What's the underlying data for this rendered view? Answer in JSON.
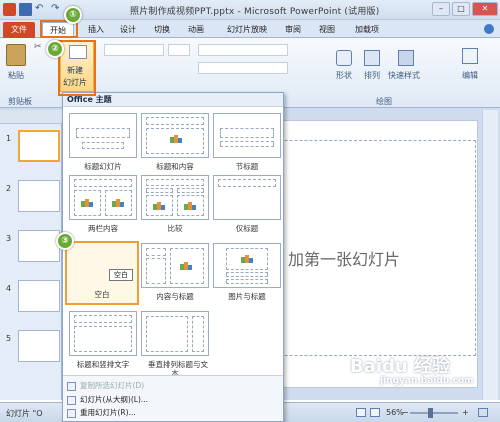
{
  "window": {
    "title": "照片制作成视频PPT.pptx - Microsoft PowerPoint (试用版)",
    "minimize": "–",
    "maximize": "□",
    "close": "✕"
  },
  "tabs": [
    "文件",
    "开始",
    "插入",
    "设计",
    "切换",
    "动画",
    "幻灯片放映",
    "审阅",
    "视图",
    "加载项"
  ],
  "ribbon": {
    "paste": "粘贴",
    "clipboard_group": "剪贴板",
    "new_slide": "新建",
    "new_slide_2": "幻灯片",
    "shapes": "形状",
    "arrange": "排列",
    "quick_styles": "快速样式",
    "drawing_group": "绘图",
    "editing": "编辑"
  },
  "steps": [
    "①",
    "②",
    "③"
  ],
  "left_pane": {
    "slides": [
      {
        "num": "1"
      },
      {
        "num": "2"
      },
      {
        "num": "3"
      },
      {
        "num": "4"
      },
      {
        "num": "5"
      }
    ]
  },
  "slide": {
    "text": "加第一张幻灯片"
  },
  "gallery": {
    "header": "Office 主题",
    "layouts": [
      {
        "label": "标题幻灯片"
      },
      {
        "label": "标题和内容"
      },
      {
        "label": "节标题"
      },
      {
        "label": "两栏内容"
      },
      {
        "label": "比较"
      },
      {
        "label": "仅标题"
      },
      {
        "label": "空白"
      },
      {
        "label": "内容与标题"
      },
      {
        "label": "图片与标题"
      },
      {
        "label": "标题和竖排文字"
      },
      {
        "label": "垂直排列标题与文"
      },
      {
        "label": "本"
      }
    ],
    "tooltip": "空白",
    "menu": [
      {
        "label": "复制所选幻灯片(D)",
        "disabled": true
      },
      {
        "label": "幻灯片(从大纲)(L)...",
        "disabled": false
      },
      {
        "label": "重用幻灯片(R)...",
        "disabled": false
      }
    ]
  },
  "status": {
    "slide_label": "幻灯片 \"O",
    "zoom": "56%",
    "minus": "−",
    "plus": "+"
  },
  "watermark": {
    "brand": "Baidu 经验",
    "url": "jingyan.baidu.com"
  },
  "colors": {
    "file_tab": "#d24726",
    "highlight": "#e8711c",
    "step_badge": "#6aa933"
  }
}
